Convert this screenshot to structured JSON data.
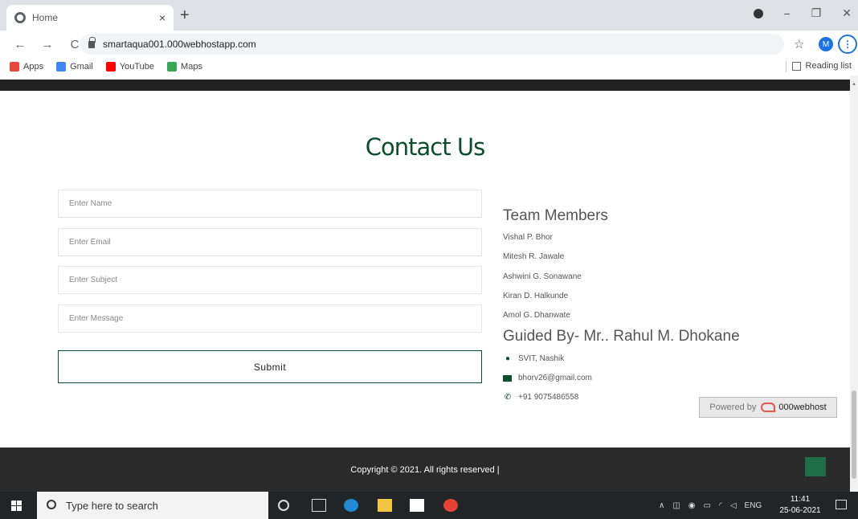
{
  "browser": {
    "tab_title": "Home",
    "tab_close": "×",
    "new_tab": "+",
    "url": "smartaqua001.000webhostapp.com",
    "profile_initial": "M",
    "menu_glyph": "⋮",
    "back_glyph": "←",
    "forward_glyph": "→",
    "reload_glyph": "C",
    "star_glyph": "☆",
    "minimize_glyph": "−",
    "maximize_glyph": "❐",
    "close_glyph": "✕"
  },
  "bookmarks": {
    "items": [
      {
        "label": "Apps",
        "color": "#e8453c"
      },
      {
        "label": "Gmail",
        "color": "#4285f4"
      },
      {
        "label": "YouTube",
        "color": "#ff0000"
      },
      {
        "label": "Maps",
        "color": "#34a853"
      }
    ],
    "reading_list": "Reading list"
  },
  "page": {
    "title": "Contact Us",
    "form": {
      "name_placeholder": "Enter Name",
      "email_placeholder": "Enter Email",
      "subject_placeholder": "Enter Subject",
      "message_placeholder": "Enter Message",
      "submit_label": "Submit"
    },
    "team": {
      "heading": "Team Members",
      "members": [
        "Vishal P. Bhor",
        "Mitesh R. Jawale",
        "Ashwini G. Sonawane",
        "Kiran D. Halkunde",
        "Amol G. Dhanwate"
      ],
      "guided_by": "Guided By- Mr.. Rahul M. Dhokane"
    },
    "contact": {
      "location": "SVIT, Nashik",
      "email": "bhorv26@gmail.com",
      "phone": "+91 9075486558"
    },
    "footer": {
      "copyright": "Copyright © 2021. All rights reserved |"
    },
    "powered": {
      "label": "Powered by",
      "brand": "000webhost"
    }
  },
  "taskbar": {
    "search_placeholder": "Type here to search",
    "tray_language": "ENG",
    "time": "11:41",
    "date": "25-06-2021"
  },
  "colors": {
    "accent": "#0b4d2e",
    "footer_bg": "#2a2a2a"
  }
}
